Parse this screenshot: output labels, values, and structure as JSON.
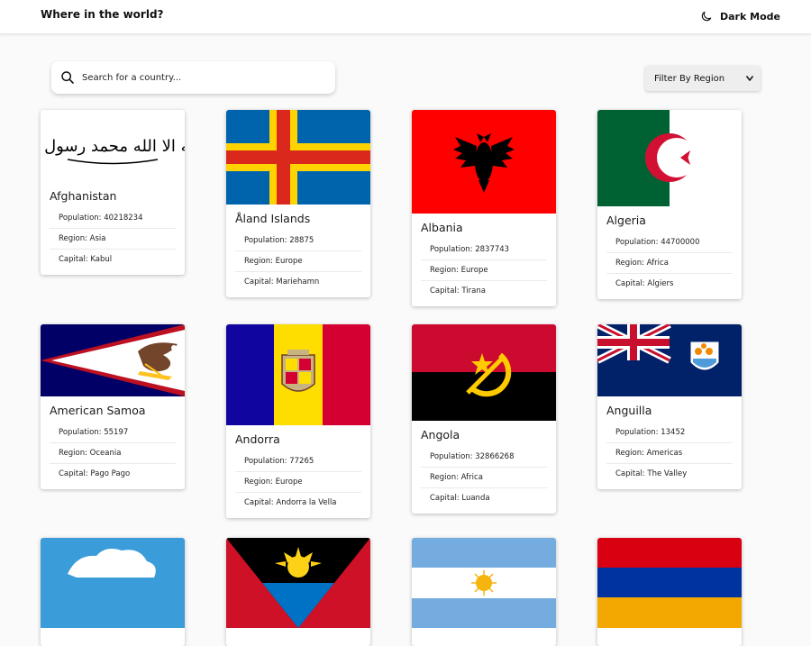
{
  "header": {
    "title": "Where in the world?",
    "dark_mode_label": "Dark Mode"
  },
  "search": {
    "placeholder": "Search for a country..."
  },
  "filter": {
    "label": "Filter By Region"
  },
  "detail_labels": {
    "population": "Population: ",
    "region": "Region: ",
    "capital": "Capital: "
  },
  "countries": [
    {
      "name": "Afghanistan",
      "population": "40218234",
      "region": "Asia",
      "capital": "Kabul",
      "flag_script": "لا اله الا الله محمد رسول الله"
    },
    {
      "name": "Åland Islands",
      "population": "28875",
      "region": "Europe",
      "capital": "Mariehamn"
    },
    {
      "name": "Albania",
      "population": "2837743",
      "region": "Europe",
      "capital": "Tirana"
    },
    {
      "name": "Algeria",
      "population": "44700000",
      "region": "Africa",
      "capital": "Algiers"
    },
    {
      "name": "American Samoa",
      "population": "55197",
      "region": "Oceania",
      "capital": "Pago Pago"
    },
    {
      "name": "Andorra",
      "population": "77265",
      "region": "Europe",
      "capital": "Andorra la Vella"
    },
    {
      "name": "Angola",
      "population": "32866268",
      "region": "Africa",
      "capital": "Luanda"
    },
    {
      "name": "Anguilla",
      "population": "13452",
      "region": "Americas",
      "capital": "The Valley"
    },
    {
      "name": "",
      "population": "",
      "region": "",
      "capital": ""
    },
    {
      "name": "",
      "population": "",
      "region": "",
      "capital": ""
    },
    {
      "name": "",
      "population": "",
      "region": "",
      "capital": ""
    },
    {
      "name": "",
      "population": "",
      "region": "",
      "capital": ""
    }
  ]
}
